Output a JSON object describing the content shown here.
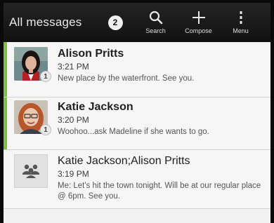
{
  "header": {
    "title": "All messages",
    "unread_count": "2",
    "actions": [
      {
        "label": "Search",
        "icon": "search-icon"
      },
      {
        "label": "Compose",
        "icon": "plus-icon"
      },
      {
        "label": "Menu",
        "icon": "overflow-menu-icon"
      }
    ]
  },
  "colors": {
    "unread_indicator": "#7dc242",
    "action_bar": "#1a1a1a"
  },
  "messages": [
    {
      "name": "Alison Pritts",
      "time": "3:21 PM",
      "snippet": "New place by the waterfront. See you.",
      "count": "1",
      "unread": true,
      "avatar": "contact-photo"
    },
    {
      "name": "Katie Jackson",
      "time": "3:20 PM",
      "snippet": "Woohoo...ask Madeline if she wants to go.",
      "count": "1",
      "unread": true,
      "avatar": "contact-photo"
    },
    {
      "name": "Katie Jackson;Alison Pritts",
      "time": "3:19 PM",
      "snippet": "Me: Let's hit the town tonight. Will be at our regular place @ 6pm. See you.",
      "unread": false,
      "avatar": "group-icon"
    }
  ]
}
